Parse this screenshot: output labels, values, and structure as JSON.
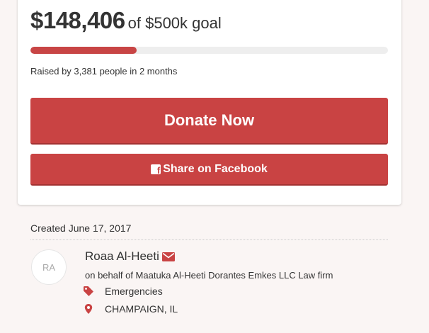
{
  "campaign": {
    "amount_raised": "$148,406",
    "goal_text": "of $500k goal",
    "progress_fraction": 0.297,
    "raised_by": "Raised by 3,381 people in 2 months"
  },
  "buttons": {
    "donate_label": "Donate Now",
    "share_label": "Share on Facebook"
  },
  "details": {
    "created": "Created June 17, 2017",
    "organizer": {
      "initials": "RA",
      "name": "Roaa Al-Heeti",
      "on_behalf": "on behalf of Maatuka Al-Heeti Dorantes Emkes LLC Law firm"
    },
    "category": "Emergencies",
    "location": "CHAMPAIGN, IL"
  },
  "icons": {
    "facebook": "facebook-icon",
    "mail": "envelope-icon",
    "tag": "tag-icon",
    "location": "map-marker-icon"
  },
  "colors": {
    "accent": "#c94343",
    "background": "#faf5f4",
    "progress_track": "#eeeeee"
  }
}
